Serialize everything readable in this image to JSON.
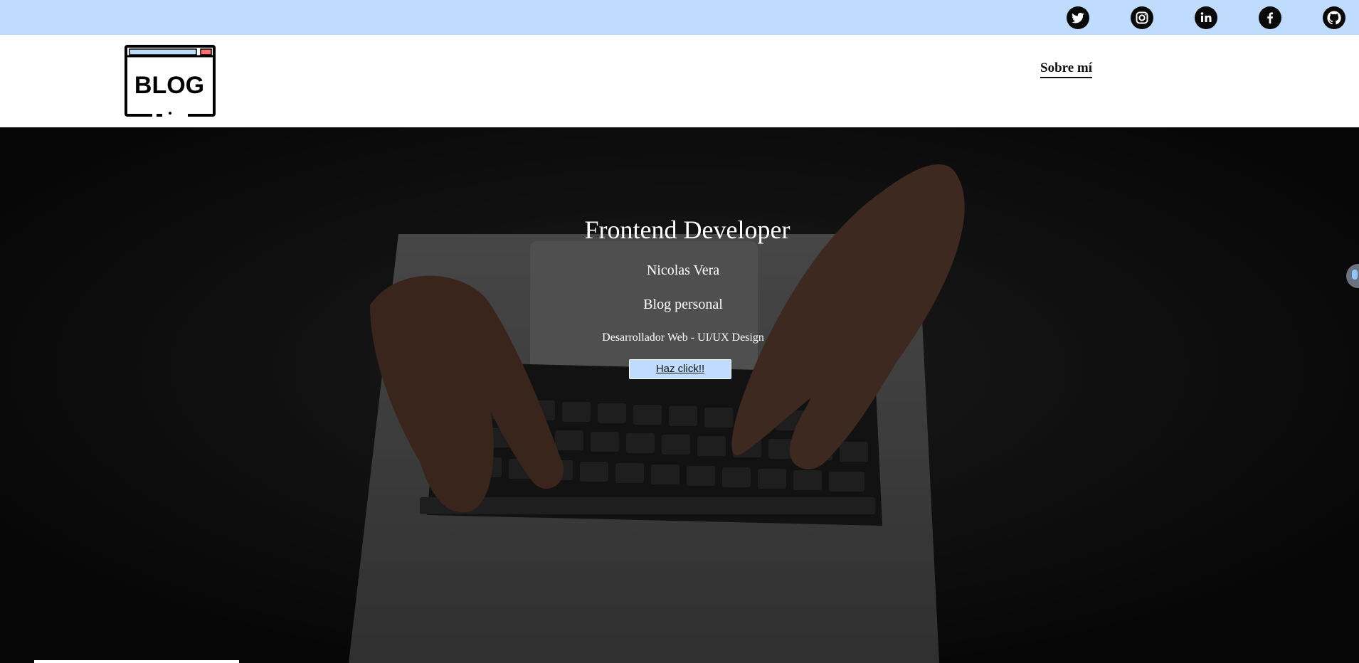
{
  "topbar": {
    "background": "#bfdbfe",
    "social": [
      {
        "icon": "twitter-icon"
      },
      {
        "icon": "instagram-icon"
      },
      {
        "icon": "linkedin-icon"
      },
      {
        "icon": "facebook-icon"
      },
      {
        "icon": "github-icon"
      }
    ]
  },
  "header": {
    "logo_text": "BLOG",
    "nav": {
      "about_label": "Sobre mí"
    }
  },
  "hero": {
    "title": "Frontend Developer",
    "name": "Nicolas Vera",
    "subtitle": "Blog personal",
    "role": "Desarrollador Web - UI/UX Design",
    "cta_label": "Haz click!!",
    "accent": "#bfdbfe"
  }
}
